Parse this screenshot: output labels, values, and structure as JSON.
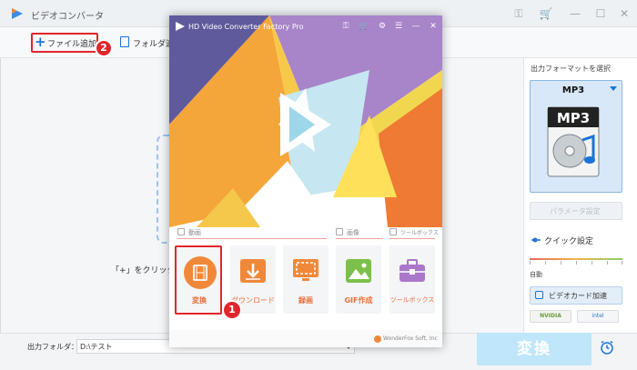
{
  "app": {
    "title": "ビデオコンバータ",
    "add_file": "ファイル追加",
    "add_folder": "フォルダ追",
    "drop_hint": "「+」をクリックし",
    "badge_two": "2"
  },
  "right_panel": {
    "heading": "出力フォーマットを選択",
    "format_name": "MP3",
    "format_art_text": "MP3",
    "param_button": "パラメータ設定",
    "quick_settings": "クイック設定",
    "speed_label": "自動",
    "gpu_button": "ビデオカード加速",
    "nvidia_label": "NVIDIA",
    "intel_label": "intel"
  },
  "bottom": {
    "output_folder_label": "出力フォルダ：",
    "output_folder_value": "D:\\テスト",
    "convert_button": "変換"
  },
  "launcher": {
    "title": "HD Video Converter Factory Pro",
    "section_video": "動画",
    "section_image": "画像",
    "section_tools": "ツールボックス",
    "tiles": [
      {
        "label": "変換",
        "color": "#f0883a"
      },
      {
        "label": "ダウンロード",
        "color": "#f0883a"
      },
      {
        "label": "録画",
        "color": "#f0883a"
      },
      {
        "label": "GIF作成",
        "color": "#7cc04a"
      },
      {
        "label": "ツールボックス",
        "color": "#a978c8"
      }
    ],
    "badge_one": "1",
    "footer": "WonderFox Soft, Inc"
  },
  "colors": {
    "accent_blue": "#1a73d8",
    "highlight_red": "#e1252b",
    "convert_orange": "#f0883a"
  }
}
